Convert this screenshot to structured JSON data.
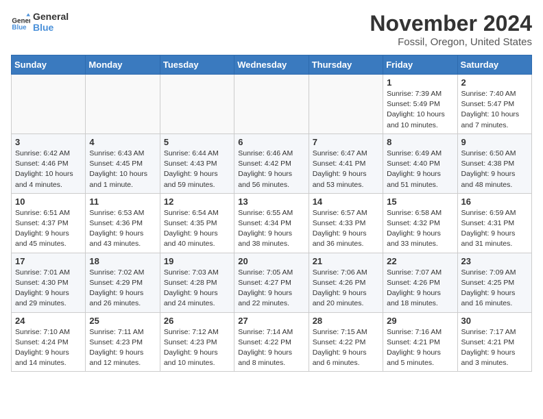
{
  "logo": {
    "text_general": "General",
    "text_blue": "Blue"
  },
  "title": "November 2024",
  "location": "Fossil, Oregon, United States",
  "header_days": [
    "Sunday",
    "Monday",
    "Tuesday",
    "Wednesday",
    "Thursday",
    "Friday",
    "Saturday"
  ],
  "weeks": [
    [
      {
        "day": "",
        "info": ""
      },
      {
        "day": "",
        "info": ""
      },
      {
        "day": "",
        "info": ""
      },
      {
        "day": "",
        "info": ""
      },
      {
        "day": "",
        "info": ""
      },
      {
        "day": "1",
        "info": "Sunrise: 7:39 AM\nSunset: 5:49 PM\nDaylight: 10 hours\nand 10 minutes."
      },
      {
        "day": "2",
        "info": "Sunrise: 7:40 AM\nSunset: 5:47 PM\nDaylight: 10 hours\nand 7 minutes."
      }
    ],
    [
      {
        "day": "3",
        "info": "Sunrise: 6:42 AM\nSunset: 4:46 PM\nDaylight: 10 hours\nand 4 minutes."
      },
      {
        "day": "4",
        "info": "Sunrise: 6:43 AM\nSunset: 4:45 PM\nDaylight: 10 hours\nand 1 minute."
      },
      {
        "day": "5",
        "info": "Sunrise: 6:44 AM\nSunset: 4:43 PM\nDaylight: 9 hours\nand 59 minutes."
      },
      {
        "day": "6",
        "info": "Sunrise: 6:46 AM\nSunset: 4:42 PM\nDaylight: 9 hours\nand 56 minutes."
      },
      {
        "day": "7",
        "info": "Sunrise: 6:47 AM\nSunset: 4:41 PM\nDaylight: 9 hours\nand 53 minutes."
      },
      {
        "day": "8",
        "info": "Sunrise: 6:49 AM\nSunset: 4:40 PM\nDaylight: 9 hours\nand 51 minutes."
      },
      {
        "day": "9",
        "info": "Sunrise: 6:50 AM\nSunset: 4:38 PM\nDaylight: 9 hours\nand 48 minutes."
      }
    ],
    [
      {
        "day": "10",
        "info": "Sunrise: 6:51 AM\nSunset: 4:37 PM\nDaylight: 9 hours\nand 45 minutes."
      },
      {
        "day": "11",
        "info": "Sunrise: 6:53 AM\nSunset: 4:36 PM\nDaylight: 9 hours\nand 43 minutes."
      },
      {
        "day": "12",
        "info": "Sunrise: 6:54 AM\nSunset: 4:35 PM\nDaylight: 9 hours\nand 40 minutes."
      },
      {
        "day": "13",
        "info": "Sunrise: 6:55 AM\nSunset: 4:34 PM\nDaylight: 9 hours\nand 38 minutes."
      },
      {
        "day": "14",
        "info": "Sunrise: 6:57 AM\nSunset: 4:33 PM\nDaylight: 9 hours\nand 36 minutes."
      },
      {
        "day": "15",
        "info": "Sunrise: 6:58 AM\nSunset: 4:32 PM\nDaylight: 9 hours\nand 33 minutes."
      },
      {
        "day": "16",
        "info": "Sunrise: 6:59 AM\nSunset: 4:31 PM\nDaylight: 9 hours\nand 31 minutes."
      }
    ],
    [
      {
        "day": "17",
        "info": "Sunrise: 7:01 AM\nSunset: 4:30 PM\nDaylight: 9 hours\nand 29 minutes."
      },
      {
        "day": "18",
        "info": "Sunrise: 7:02 AM\nSunset: 4:29 PM\nDaylight: 9 hours\nand 26 minutes."
      },
      {
        "day": "19",
        "info": "Sunrise: 7:03 AM\nSunset: 4:28 PM\nDaylight: 9 hours\nand 24 minutes."
      },
      {
        "day": "20",
        "info": "Sunrise: 7:05 AM\nSunset: 4:27 PM\nDaylight: 9 hours\nand 22 minutes."
      },
      {
        "day": "21",
        "info": "Sunrise: 7:06 AM\nSunset: 4:26 PM\nDaylight: 9 hours\nand 20 minutes."
      },
      {
        "day": "22",
        "info": "Sunrise: 7:07 AM\nSunset: 4:26 PM\nDaylight: 9 hours\nand 18 minutes."
      },
      {
        "day": "23",
        "info": "Sunrise: 7:09 AM\nSunset: 4:25 PM\nDaylight: 9 hours\nand 16 minutes."
      }
    ],
    [
      {
        "day": "24",
        "info": "Sunrise: 7:10 AM\nSunset: 4:24 PM\nDaylight: 9 hours\nand 14 minutes."
      },
      {
        "day": "25",
        "info": "Sunrise: 7:11 AM\nSunset: 4:23 PM\nDaylight: 9 hours\nand 12 minutes."
      },
      {
        "day": "26",
        "info": "Sunrise: 7:12 AM\nSunset: 4:23 PM\nDaylight: 9 hours\nand 10 minutes."
      },
      {
        "day": "27",
        "info": "Sunrise: 7:14 AM\nSunset: 4:22 PM\nDaylight: 9 hours\nand 8 minutes."
      },
      {
        "day": "28",
        "info": "Sunrise: 7:15 AM\nSunset: 4:22 PM\nDaylight: 9 hours\nand 6 minutes."
      },
      {
        "day": "29",
        "info": "Sunrise: 7:16 AM\nSunset: 4:21 PM\nDaylight: 9 hours\nand 5 minutes."
      },
      {
        "day": "30",
        "info": "Sunrise: 7:17 AM\nSunset: 4:21 PM\nDaylight: 9 hours\nand 3 minutes."
      }
    ]
  ]
}
